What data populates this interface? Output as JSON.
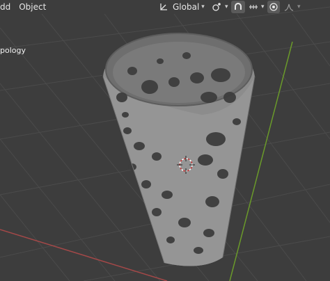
{
  "header": {
    "menu_items": [
      "dd",
      "Object"
    ],
    "orientation_label": "Global"
  },
  "viewport": {
    "overlay_label": "pology"
  },
  "colors": {
    "background": "#3d3d3d",
    "grid": "#4a4a4a",
    "x_axis": "#b34a4a",
    "y_axis": "#6e9b2c",
    "mesh": "#8a8a8a",
    "mesh_inner": "#707070"
  }
}
